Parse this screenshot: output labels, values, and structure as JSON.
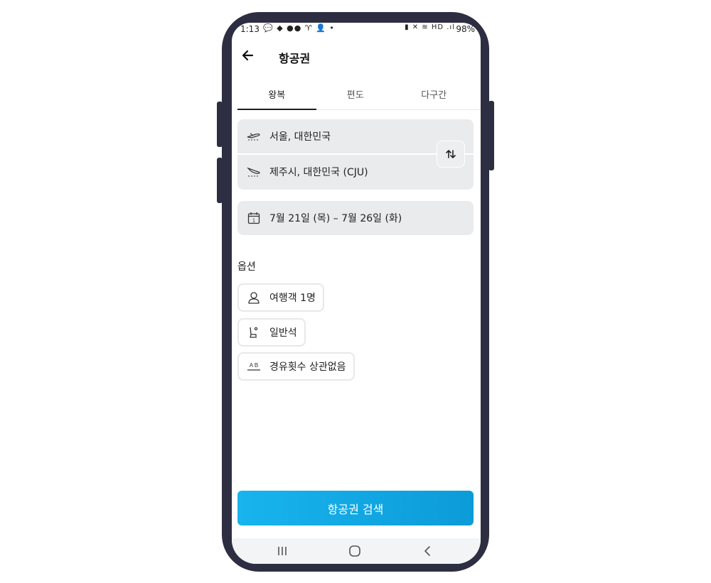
{
  "status": {
    "time": "1:13",
    "left_icons": "💬 ◆ ●● ♈ 👤 •",
    "right_icons": "▮ ✕ ≋ HD .ıl",
    "battery": "98%"
  },
  "appbar": {
    "title": "항공권",
    "back_icon": "back-arrow-icon"
  },
  "tabs": [
    {
      "label": "왕복",
      "active": true
    },
    {
      "label": "편도",
      "active": false
    },
    {
      "label": "다구간",
      "active": false
    }
  ],
  "route": {
    "origin": "서울, 대한민국",
    "destination": "제주시, 대한민국 (CJU)"
  },
  "dates": {
    "range": "7월 21일 (목)  –  7월 26일 (화)",
    "calendar_day": "1"
  },
  "options": {
    "heading": "옵션",
    "travelers": "여행객 1명",
    "cabin": "일반석",
    "stops": "경유횟수 상관없음",
    "stops_icon_text": "A B"
  },
  "search_button": "항공권 검색",
  "colors": {
    "accent": "#12a9e6",
    "frame": "#2e2e42",
    "field_bg": "#e9ebed"
  }
}
